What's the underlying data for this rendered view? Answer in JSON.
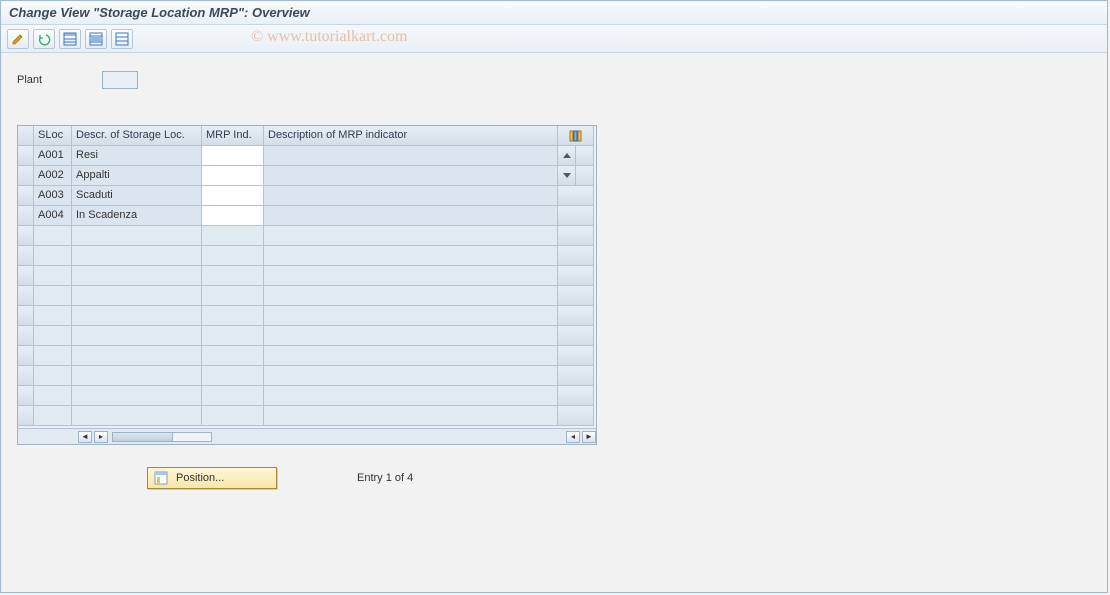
{
  "title": "Change View \"Storage Location MRP\": Overview",
  "watermark": "© www.tutorialkart.com",
  "toolbar": {
    "edit": "edit-icon",
    "undo": "undo-icon",
    "table1": "table-icon",
    "table2": "table-variant-icon",
    "table3": "table-frame-icon"
  },
  "fields": {
    "plant_label": "Plant",
    "plant_value": ""
  },
  "columns": {
    "sloc": "SLoc",
    "descr": "Descr. of Storage Loc.",
    "mrp": "MRP Ind.",
    "mrp_descr": "Description of MRP indicator"
  },
  "rows": [
    {
      "sloc": "A001",
      "descr": "Resi",
      "mrp": "",
      "mrp_descr": ""
    },
    {
      "sloc": "A002",
      "descr": "Appalti",
      "mrp": "",
      "mrp_descr": ""
    },
    {
      "sloc": "A003",
      "descr": "Scaduti",
      "mrp": "",
      "mrp_descr": ""
    },
    {
      "sloc": "A004",
      "descr": "In Scadenza",
      "mrp": "",
      "mrp_descr": ""
    }
  ],
  "empty_rows": 10,
  "footer": {
    "position_label": "Position...",
    "entry_text": "Entry 1 of 4"
  }
}
